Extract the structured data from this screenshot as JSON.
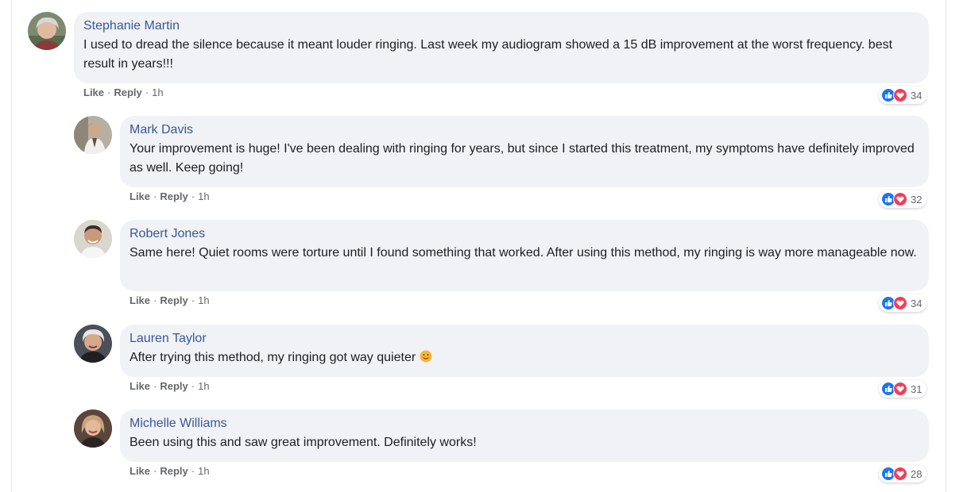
{
  "comments": [
    {
      "author": "Stephanie Martin",
      "text": "I used to dread the silence because it meant louder ringing. Last week my audiogram showed a 15 dB improvement at the worst frequency. best result in years!!!",
      "like": "Like",
      "reply": "Reply",
      "time": "1h",
      "reaction_count": "34"
    },
    {
      "author": "Mark Davis",
      "text": "Your improvement is huge! I've been dealing with ringing for years, but since I started this treatment, my symptoms have definitely improved as well. Keep going!",
      "like": "Like",
      "reply": "Reply",
      "time": "1h",
      "reaction_count": "32"
    },
    {
      "author": "Robert Jones",
      "text": "Same here! Quiet rooms were torture until I found something that worked. After using this method, my ringing is way more manageable now.",
      "like": "Like",
      "reply": "Reply",
      "time": "1h",
      "reaction_count": "34"
    },
    {
      "author": "Lauren Taylor",
      "text": "After trying this method, my ringing got way quieter",
      "like": "Like",
      "reply": "Reply",
      "time": "1h",
      "reaction_count": "31"
    },
    {
      "author": "Michelle Williams",
      "text": "Been using this and saw great improvement. Definitely works!",
      "like": "Like",
      "reply": "Reply",
      "time": "1h",
      "reaction_count": "28"
    }
  ],
  "icons": {
    "like": "thumbs-up-icon",
    "love": "heart-icon",
    "emoji": "smiling-face-emoji"
  },
  "colors": {
    "author_link": "#385898",
    "like_blue": "#1877f2",
    "love_red": "#f33e58",
    "bubble_bg": "#f0f2f5"
  }
}
